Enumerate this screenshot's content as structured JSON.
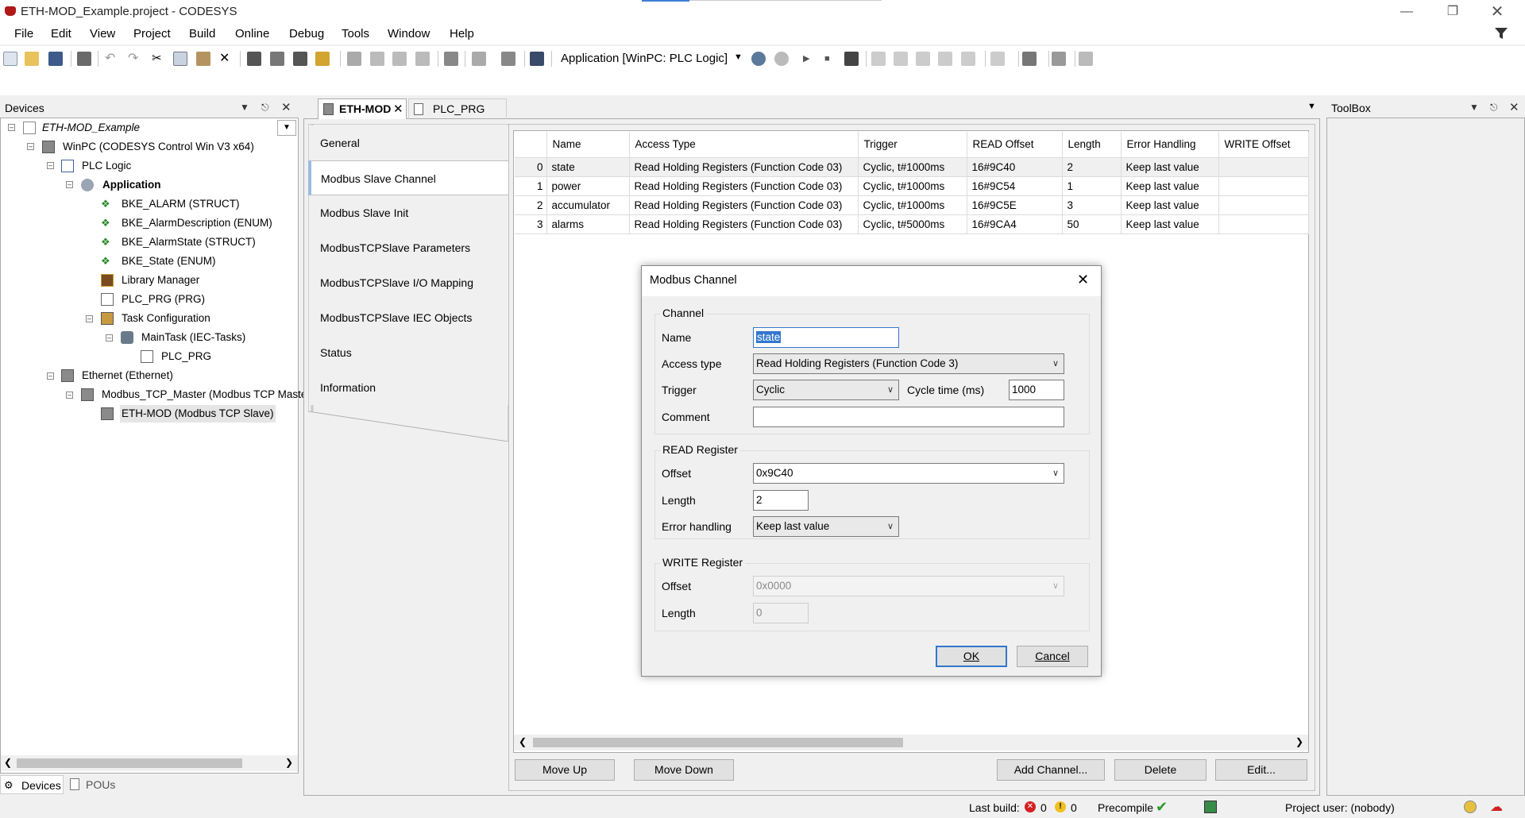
{
  "window": {
    "title": "ETH-MOD_Example.project - CODESYS"
  },
  "menu": [
    "File",
    "Edit",
    "View",
    "Project",
    "Build",
    "Online",
    "Debug",
    "Tools",
    "Window",
    "Help"
  ],
  "toolbar": {
    "application_selector": "Application [WinPC: PLC Logic]"
  },
  "devices_panel": {
    "title": "Devices",
    "tree": [
      {
        "label": "ETH-MOD_Example",
        "italic": true
      },
      {
        "label": "WinPC (CODESYS Control Win V3 x64)"
      },
      {
        "label": "PLC Logic"
      },
      {
        "label": "Application",
        "bold": true
      },
      {
        "label": "BKE_ALARM (STRUCT)"
      },
      {
        "label": "BKE_AlarmDescription (ENUM)"
      },
      {
        "label": "BKE_AlarmState (STRUCT)"
      },
      {
        "label": "BKE_State (ENUM)"
      },
      {
        "label": "Library Manager"
      },
      {
        "label": "PLC_PRG (PRG)"
      },
      {
        "label": "Task Configuration"
      },
      {
        "label": "MainTask (IEC-Tasks)"
      },
      {
        "label": "PLC_PRG"
      },
      {
        "label": "Ethernet (Ethernet)"
      },
      {
        "label": "Modbus_TCP_Master (Modbus TCP Maste"
      },
      {
        "label": "ETH-MOD (Modbus TCP Slave)"
      }
    ],
    "bottom_tabs": [
      "Devices",
      "POUs"
    ]
  },
  "editor": {
    "tabs": [
      "ETH-MOD",
      "PLC_PRG"
    ],
    "nav": [
      "General",
      "Modbus Slave Channel",
      "Modbus Slave Init",
      "ModbusTCPSlave Parameters",
      "ModbusTCPSlave I/O Mapping",
      "ModbusTCPSlave IEC Objects",
      "Status",
      "Information"
    ],
    "columns": [
      "Name",
      "Access Type",
      "Trigger",
      "READ Offset",
      "Length",
      "Error Handling",
      "WRITE Offset"
    ],
    "rows": [
      {
        "idx": "0",
        "name": "state",
        "access": "Read Holding Registers (Function Code 03)",
        "trigger": "Cyclic, t#1000ms",
        "read_offset": "16#9C40",
        "length": "2",
        "error": "Keep last value",
        "write_offset": ""
      },
      {
        "idx": "1",
        "name": "power",
        "access": "Read Holding Registers (Function Code 03)",
        "trigger": "Cyclic, t#1000ms",
        "read_offset": "16#9C54",
        "length": "1",
        "error": "Keep last value",
        "write_offset": ""
      },
      {
        "idx": "2",
        "name": "accumulator",
        "access": "Read Holding Registers (Function Code 03)",
        "trigger": "Cyclic, t#1000ms",
        "read_offset": "16#9C5E",
        "length": "3",
        "error": "Keep last value",
        "write_offset": ""
      },
      {
        "idx": "3",
        "name": "alarms",
        "access": "Read Holding Registers (Function Code 03)",
        "trigger": "Cyclic, t#5000ms",
        "read_offset": "16#9CA4",
        "length": "50",
        "error": "Keep last value",
        "write_offset": ""
      }
    ],
    "buttons": {
      "move_up": "Move Up",
      "move_down": "Move Down",
      "add_channel": "Add Channel...",
      "delete": "Delete",
      "edit": "Edit..."
    }
  },
  "toolbox": {
    "title": "ToolBox"
  },
  "dialog": {
    "title": "Modbus Channel",
    "channel_group": "Channel",
    "name_label": "Name",
    "name_value": "state",
    "access_label": "Access type",
    "access_value": "Read Holding Registers (Function Code 3)",
    "trigger_label": "Trigger",
    "trigger_value": "Cyclic",
    "cycle_label": "Cycle time (ms)",
    "cycle_value": "1000",
    "comment_label": "Comment",
    "comment_value": "",
    "read_group": "READ Register",
    "read_offset_label": "Offset",
    "read_offset_value": "0x9C40",
    "read_length_label": "Length",
    "read_length_value": "2",
    "error_label": "Error handling",
    "error_value": "Keep last value",
    "write_group": "WRITE Register",
    "write_offset_label": "Offset",
    "write_offset_value": "0x0000",
    "write_length_label": "Length",
    "write_length_value": "0",
    "ok": "OK",
    "cancel": "Cancel"
  },
  "status": {
    "last_build_label": "Last build:",
    "errors": "0",
    "warnings": "0",
    "precompile": "Precompile",
    "project_user": "Project user: (nobody)"
  }
}
